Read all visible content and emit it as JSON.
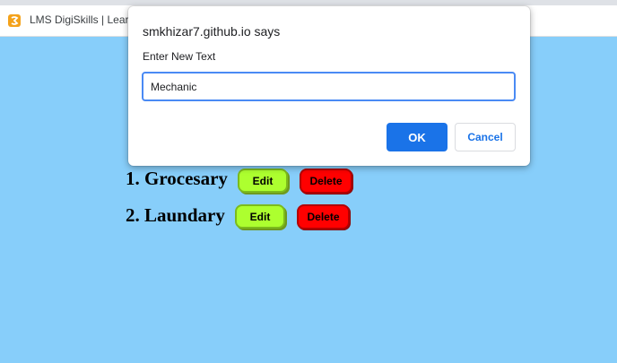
{
  "browser": {
    "tab_title": "LMS DigiSkills | Lear..."
  },
  "dialog": {
    "origin": "smkhizar7.github.io says",
    "message": "Enter New Text",
    "input_value": "Mechanic",
    "ok_label": "OK",
    "cancel_label": "Cancel"
  },
  "list": {
    "items": [
      {
        "label": "1. Grocesary",
        "edit_label": "Edit",
        "delete_label": "Delete"
      },
      {
        "label": "2. Laundary",
        "edit_label": "Edit",
        "delete_label": "Delete"
      }
    ]
  },
  "colors": {
    "page_background": "#87cefa",
    "edit_button": "#adff2f",
    "delete_button": "#ff0000",
    "ok_button": "#1a73e8"
  }
}
